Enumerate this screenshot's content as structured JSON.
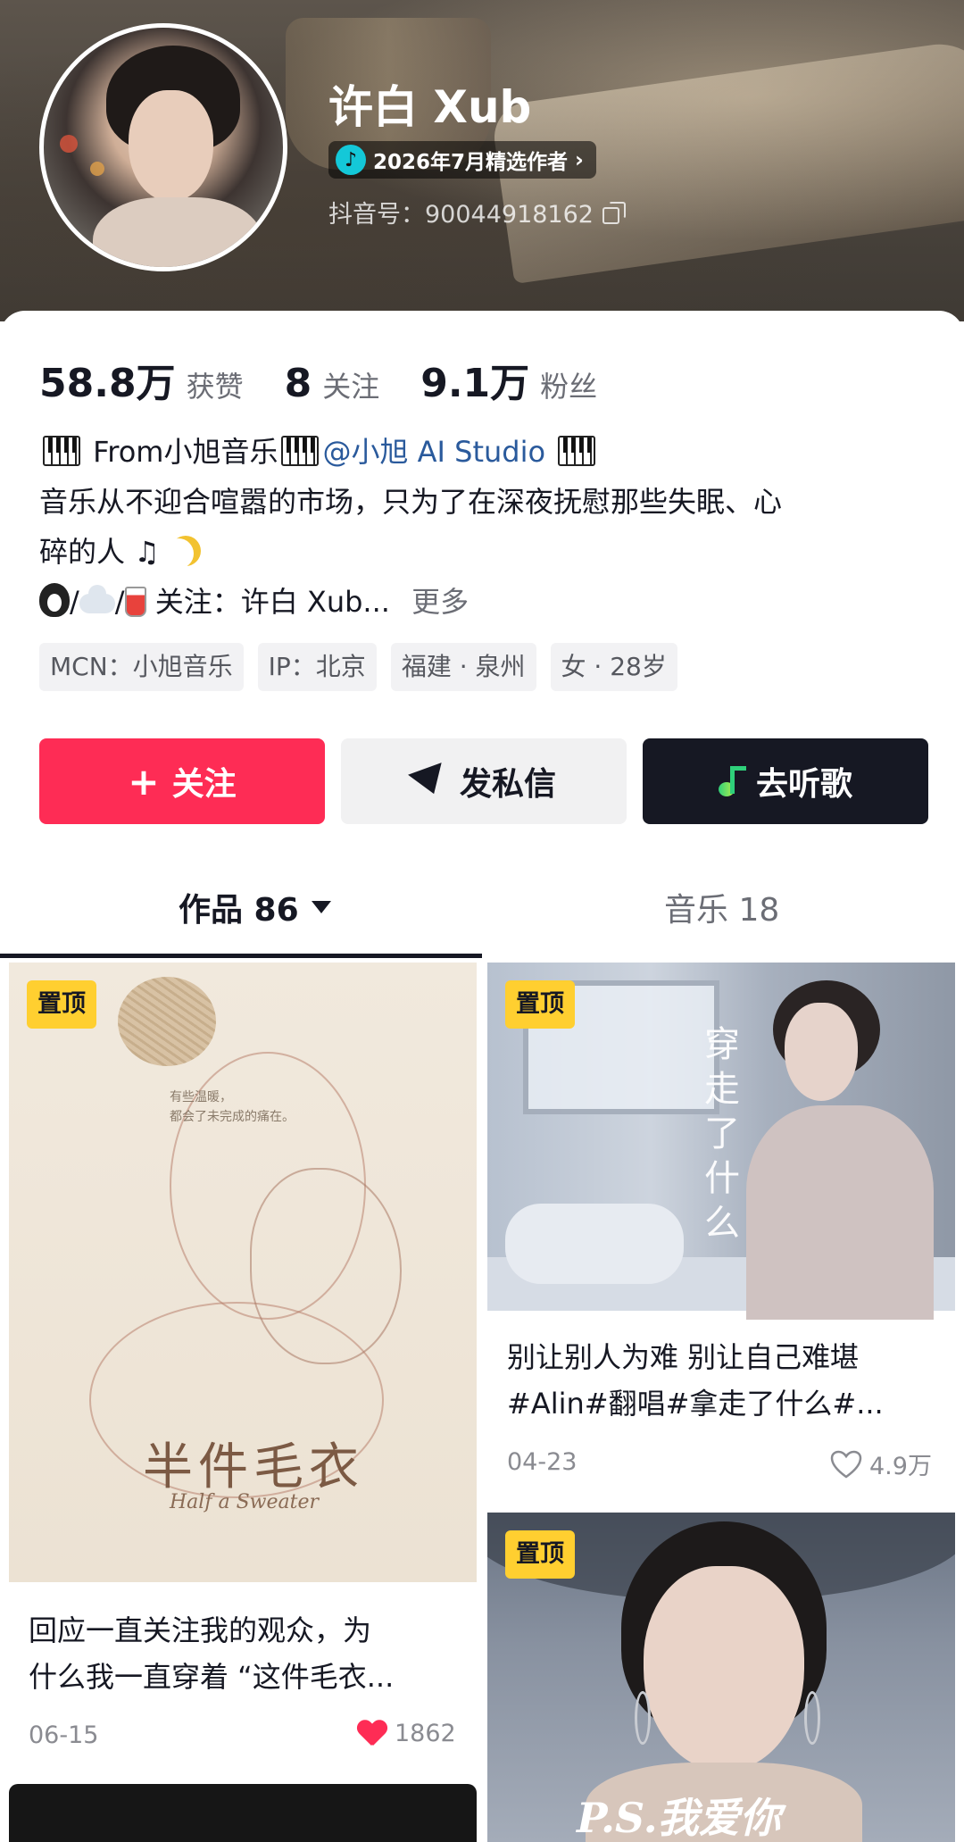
{
  "profile": {
    "username": "许白 Xub",
    "badge": "2026年7月精选作者",
    "badge_chevron": "›",
    "douyin_id": "抖音号：90044918162"
  },
  "stats": [
    {
      "value": "58.8万",
      "label": "获赞"
    },
    {
      "value": "8",
      "label": "关注"
    },
    {
      "value": "9.1万",
      "label": "粉丝"
    }
  ],
  "bio": {
    "line1_prefix": " From小旭音乐",
    "mention": "@小旭 AI Studio",
    "line2": "音乐从不迎合喧嚣的市场，只为了在深夜抚慰那些失眠、心",
    "line3": "碎的人",
    "line3_note": "♫",
    "line4_sep1": "/",
    "line4_sep2": "/",
    "line4_text": "关注：许白 Xub...",
    "more": "更多"
  },
  "tags": [
    "MCN：小旭音乐",
    "IP：北京",
    "福建 · 泉州",
    "女 · 28岁"
  ],
  "actions": {
    "follow_plus": "+",
    "follow": "关注",
    "message": "发私信",
    "listen": "去听歌"
  },
  "tabs": {
    "works_label": "作品 86",
    "music_label": "音乐 18"
  },
  "videos": [
    {
      "pin": "置顶",
      "cover_small_1": "有些温暖，",
      "cover_small_2": "都会了未完成的痛在。",
      "cover_title": "半件毛衣",
      "cover_subtitle": "Half a Sweater",
      "caption_line1": "回应一直关注我的观众，为",
      "caption_line2": "什么我一直穿着 “这件毛衣...",
      "date": "06-15",
      "likes": "1862"
    },
    {
      "pin": "置顶",
      "cover_vertical": "穿走了什么",
      "caption_line1": "别让别人为难 别让自己难堪",
      "caption_line2": "#Alin#翻唱#拿走了什么#...",
      "date": "04-23",
      "likes": "4.9万"
    },
    {
      "pin": "置顶",
      "cover_title": "P.S.我爱你"
    }
  ],
  "colors": {
    "accent_red": "#fe2c55",
    "pin_yellow": "#ffcf30",
    "dark": "#161823"
  }
}
